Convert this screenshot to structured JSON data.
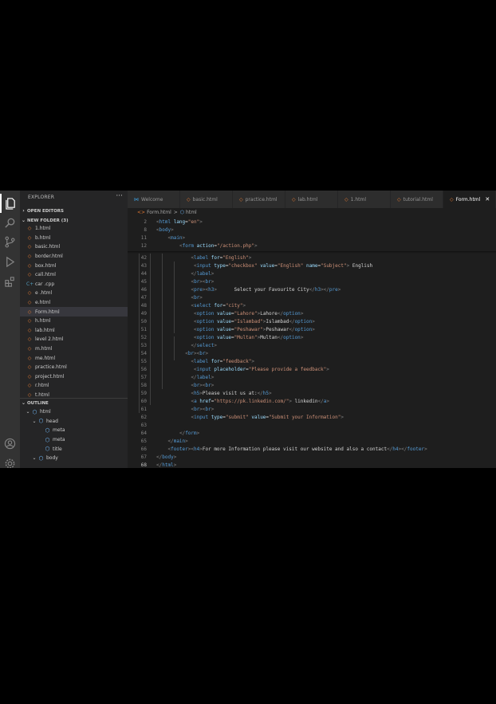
{
  "sidebar": {
    "title": "EXPLORER",
    "more": "···",
    "open_editors": "OPEN EDITORS",
    "folder": "NEW FOLDER (3)",
    "files": [
      {
        "name": "1.html",
        "kind": "html"
      },
      {
        "name": "b.html",
        "kind": "html"
      },
      {
        "name": "basic.html",
        "kind": "html"
      },
      {
        "name": "border.html",
        "kind": "html"
      },
      {
        "name": "box.html",
        "kind": "html"
      },
      {
        "name": "call.html",
        "kind": "html"
      },
      {
        "name": "car .cpp",
        "kind": "cpp"
      },
      {
        "name": "e .html",
        "kind": "html"
      },
      {
        "name": "e.html",
        "kind": "html"
      },
      {
        "name": "Form.html",
        "kind": "html",
        "active": true
      },
      {
        "name": "h.html",
        "kind": "html"
      },
      {
        "name": "lab.html",
        "kind": "html"
      },
      {
        "name": "level 2.html",
        "kind": "html"
      },
      {
        "name": "m.html",
        "kind": "html"
      },
      {
        "name": "me.html",
        "kind": "html"
      },
      {
        "name": "practice.html",
        "kind": "html"
      },
      {
        "name": "project.html",
        "kind": "html"
      },
      {
        "name": "r.html",
        "kind": "html"
      },
      {
        "name": "t.html",
        "kind": "html"
      }
    ],
    "outline_title": "OUTLINE",
    "outline": [
      {
        "label": "html",
        "depth": 0
      },
      {
        "label": "head",
        "depth": 1
      },
      {
        "label": "meta",
        "depth": 2
      },
      {
        "label": "meta",
        "depth": 2
      },
      {
        "label": "title",
        "depth": 2
      },
      {
        "label": "body",
        "depth": 1
      }
    ]
  },
  "tabs": [
    {
      "label": "Welcome",
      "icon": "vscode-icon",
      "active": false
    },
    {
      "label": "basic.html",
      "icon": "html-icon",
      "active": false
    },
    {
      "label": "practice.html",
      "icon": "html-icon",
      "active": false
    },
    {
      "label": "lab.html",
      "icon": "html-icon",
      "active": false
    },
    {
      "label": "1.html",
      "icon": "html-icon",
      "active": false
    },
    {
      "label": "tutorial.html",
      "icon": "html-icon",
      "active": false
    },
    {
      "label": "Form.html",
      "icon": "html-icon",
      "active": true,
      "close": "✕"
    }
  ],
  "breadcrumb": {
    "file": "Form.html",
    "separator": ">",
    "element": "html"
  },
  "editor": {
    "current_line": "68",
    "sticky": [
      {
        "ln": "2",
        "indent": 0,
        "tokens": [
          [
            "p",
            "<"
          ],
          [
            "t",
            "html"
          ],
          [
            "x",
            " "
          ],
          [
            "a",
            "lang"
          ],
          [
            "x",
            "="
          ],
          [
            "s",
            "\"en\""
          ],
          [
            "p",
            ">"
          ]
        ]
      },
      {
        "ln": "8",
        "indent": 0,
        "tokens": [
          [
            "p",
            "<"
          ],
          [
            "t",
            "body"
          ],
          [
            "p",
            ">"
          ]
        ]
      },
      {
        "ln": "11",
        "indent": 4,
        "tokens": [
          [
            "p",
            "<"
          ],
          [
            "t",
            "main"
          ],
          [
            "p",
            ">"
          ]
        ]
      },
      {
        "ln": "12",
        "indent": 8,
        "tokens": [
          [
            "p",
            "<"
          ],
          [
            "t",
            "form"
          ],
          [
            "x",
            " "
          ],
          [
            "a",
            "action"
          ],
          [
            "x",
            "="
          ],
          [
            "s",
            "\"/action.php\""
          ],
          [
            "p",
            ">"
          ]
        ]
      }
    ],
    "lines": [
      {
        "ln": "42",
        "indent": 12,
        "tokens": [
          [
            "p",
            "<"
          ],
          [
            "t",
            "label"
          ],
          [
            "x",
            " "
          ],
          [
            "a",
            "for"
          ],
          [
            "x",
            "="
          ],
          [
            "s",
            "\"English\""
          ],
          [
            "p",
            ">"
          ]
        ]
      },
      {
        "ln": "43",
        "indent": 13,
        "tokens": [
          [
            "p",
            "<"
          ],
          [
            "t",
            "input"
          ],
          [
            "x",
            " "
          ],
          [
            "a",
            "type"
          ],
          [
            "x",
            "="
          ],
          [
            "s",
            "\"checkbox\""
          ],
          [
            "x",
            " "
          ],
          [
            "a",
            "value"
          ],
          [
            "x",
            "="
          ],
          [
            "s",
            "\"English\""
          ],
          [
            "x",
            " "
          ],
          [
            "a",
            "name"
          ],
          [
            "x",
            "="
          ],
          [
            "s",
            "\"Subject\""
          ],
          [
            "p",
            ">"
          ],
          [
            "x",
            " English"
          ]
        ]
      },
      {
        "ln": "44",
        "indent": 12,
        "tokens": [
          [
            "p",
            "</"
          ],
          [
            "t",
            "label"
          ],
          [
            "p",
            ">"
          ]
        ]
      },
      {
        "ln": "45",
        "indent": 12,
        "tokens": [
          [
            "p",
            "<"
          ],
          [
            "t",
            "br"
          ],
          [
            "p",
            "><"
          ],
          [
            "t",
            "br"
          ],
          [
            "p",
            ">"
          ]
        ]
      },
      {
        "ln": "46",
        "indent": 12,
        "tokens": [
          [
            "p",
            "<"
          ],
          [
            "t",
            "pre"
          ],
          [
            "p",
            "><"
          ],
          [
            "t",
            "h3"
          ],
          [
            "p",
            ">"
          ],
          [
            "x",
            "      Select your Favourite City"
          ],
          [
            "p",
            "</"
          ],
          [
            "t",
            "h3"
          ],
          [
            "p",
            "></"
          ],
          [
            "t",
            "pre"
          ],
          [
            "p",
            ">"
          ]
        ]
      },
      {
        "ln": "47",
        "indent": 12,
        "tokens": [
          [
            "p",
            "<"
          ],
          [
            "t",
            "br"
          ],
          [
            "p",
            ">"
          ]
        ]
      },
      {
        "ln": "48",
        "indent": 12,
        "tokens": [
          [
            "p",
            "<"
          ],
          [
            "t",
            "select"
          ],
          [
            "x",
            " "
          ],
          [
            "a",
            "for"
          ],
          [
            "x",
            "="
          ],
          [
            "s",
            "\"city\""
          ],
          [
            "p",
            ">"
          ]
        ]
      },
      {
        "ln": "49",
        "indent": 13,
        "tokens": [
          [
            "p",
            "<"
          ],
          [
            "t",
            "option"
          ],
          [
            "x",
            " "
          ],
          [
            "a",
            "value"
          ],
          [
            "x",
            "="
          ],
          [
            "s",
            "\"Lahore\""
          ],
          [
            "p",
            ">"
          ],
          [
            "x",
            "Lahore"
          ],
          [
            "p",
            "</"
          ],
          [
            "t",
            "option"
          ],
          [
            "p",
            ">"
          ]
        ]
      },
      {
        "ln": "50",
        "indent": 13,
        "tokens": [
          [
            "p",
            "<"
          ],
          [
            "t",
            "option"
          ],
          [
            "x",
            " "
          ],
          [
            "a",
            "value"
          ],
          [
            "x",
            "="
          ],
          [
            "s",
            "\"Islambad\""
          ],
          [
            "p",
            ">"
          ],
          [
            "x",
            "Islambad"
          ],
          [
            "p",
            "</"
          ],
          [
            "t",
            "option"
          ],
          [
            "p",
            ">"
          ]
        ]
      },
      {
        "ln": "51",
        "indent": 13,
        "tokens": [
          [
            "p",
            "<"
          ],
          [
            "t",
            "option"
          ],
          [
            "x",
            " "
          ],
          [
            "a",
            "value"
          ],
          [
            "x",
            "="
          ],
          [
            "s",
            "\"Peshawar\""
          ],
          [
            "p",
            ">"
          ],
          [
            "x",
            "Peshawar"
          ],
          [
            "p",
            "</"
          ],
          [
            "t",
            "option"
          ],
          [
            "p",
            ">"
          ]
        ]
      },
      {
        "ln": "52",
        "indent": 13,
        "tokens": [
          [
            "p",
            "<"
          ],
          [
            "t",
            "option"
          ],
          [
            "x",
            " "
          ],
          [
            "a",
            "value"
          ],
          [
            "x",
            "="
          ],
          [
            "s",
            "\"Multan\""
          ],
          [
            "p",
            ">"
          ],
          [
            "x",
            "Multan"
          ],
          [
            "p",
            "</"
          ],
          [
            "t",
            "option"
          ],
          [
            "p",
            ">"
          ]
        ]
      },
      {
        "ln": "53",
        "indent": 12,
        "tokens": [
          [
            "p",
            "</"
          ],
          [
            "t",
            "select"
          ],
          [
            "p",
            ">"
          ]
        ]
      },
      {
        "ln": "54",
        "indent": 10,
        "tokens": [
          [
            "p",
            "<"
          ],
          [
            "t",
            "br"
          ],
          [
            "p",
            "><"
          ],
          [
            "t",
            "br"
          ],
          [
            "p",
            ">"
          ]
        ]
      },
      {
        "ln": "55",
        "indent": 12,
        "tokens": [
          [
            "p",
            "<"
          ],
          [
            "t",
            "label"
          ],
          [
            "x",
            " "
          ],
          [
            "a",
            "for"
          ],
          [
            "x",
            "="
          ],
          [
            "s",
            "\"feedback\""
          ],
          [
            "p",
            ">"
          ]
        ]
      },
      {
        "ln": "56",
        "indent": 13,
        "tokens": [
          [
            "p",
            "<"
          ],
          [
            "t",
            "input"
          ],
          [
            "x",
            " "
          ],
          [
            "a",
            "placeholder"
          ],
          [
            "x",
            "="
          ],
          [
            "s",
            "\"Please provide a feedback\""
          ],
          [
            "p",
            ">"
          ]
        ]
      },
      {
        "ln": "57",
        "indent": 12,
        "tokens": [
          [
            "p",
            "</"
          ],
          [
            "t",
            "label"
          ],
          [
            "p",
            ">"
          ]
        ]
      },
      {
        "ln": "58",
        "indent": 12,
        "tokens": [
          [
            "p",
            "<"
          ],
          [
            "t",
            "br"
          ],
          [
            "p",
            "><"
          ],
          [
            "t",
            "br"
          ],
          [
            "p",
            ">"
          ]
        ]
      },
      {
        "ln": "59",
        "indent": 12,
        "tokens": [
          [
            "p",
            "<"
          ],
          [
            "t",
            "h5"
          ],
          [
            "p",
            ">"
          ],
          [
            "x",
            "Please visit us at:"
          ],
          [
            "p",
            "</"
          ],
          [
            "t",
            "h5"
          ],
          [
            "p",
            ">"
          ]
        ]
      },
      {
        "ln": "60",
        "indent": 12,
        "tokens": [
          [
            "p",
            "<"
          ],
          [
            "t",
            "a"
          ],
          [
            "x",
            " "
          ],
          [
            "a",
            "href"
          ],
          [
            "x",
            "="
          ],
          [
            "s",
            "\"https://pk.linkedin.com/\""
          ],
          [
            "p",
            ">"
          ],
          [
            "x",
            " linkedin"
          ],
          [
            "p",
            "</"
          ],
          [
            "t",
            "a"
          ],
          [
            "p",
            ">"
          ]
        ]
      },
      {
        "ln": "61",
        "indent": 12,
        "tokens": [
          [
            "p",
            "<"
          ],
          [
            "t",
            "br"
          ],
          [
            "p",
            "><"
          ],
          [
            "t",
            "br"
          ],
          [
            "p",
            ">"
          ]
        ]
      },
      {
        "ln": "62",
        "indent": 12,
        "tokens": [
          [
            "p",
            "<"
          ],
          [
            "t",
            "input"
          ],
          [
            "x",
            " "
          ],
          [
            "a",
            "type"
          ],
          [
            "x",
            "="
          ],
          [
            "s",
            "\"submit\""
          ],
          [
            "x",
            " "
          ],
          [
            "a",
            "value"
          ],
          [
            "x",
            "="
          ],
          [
            "s",
            "\"Submit your Information\""
          ],
          [
            "p",
            ">"
          ]
        ]
      },
      {
        "ln": "63",
        "indent": 0,
        "tokens": []
      },
      {
        "ln": "64",
        "indent": 8,
        "tokens": [
          [
            "p",
            "</"
          ],
          [
            "t",
            "form"
          ],
          [
            "p",
            ">"
          ]
        ]
      },
      {
        "ln": "65",
        "indent": 4,
        "tokens": [
          [
            "p",
            "</"
          ],
          [
            "t",
            "main"
          ],
          [
            "p",
            ">"
          ]
        ]
      },
      {
        "ln": "66",
        "indent": 4,
        "tokens": [
          [
            "p",
            "<"
          ],
          [
            "t",
            "footer"
          ],
          [
            "p",
            "><"
          ],
          [
            "t",
            "h4"
          ],
          [
            "p",
            ">"
          ],
          [
            "x",
            "For more Information please visit our website and also a contact"
          ],
          [
            "p",
            "</"
          ],
          [
            "t",
            "h4"
          ],
          [
            "p",
            "></"
          ],
          [
            "t",
            "footer"
          ],
          [
            "p",
            ">"
          ]
        ]
      },
      {
        "ln": "67",
        "indent": 0,
        "tokens": [
          [
            "p",
            "</"
          ],
          [
            "t",
            "body"
          ],
          [
            "p",
            ">"
          ]
        ]
      },
      {
        "ln": "68",
        "indent": 0,
        "tokens": [
          [
            "p",
            "</"
          ],
          [
            "t",
            "html"
          ],
          [
            "p",
            ">"
          ]
        ]
      }
    ]
  }
}
